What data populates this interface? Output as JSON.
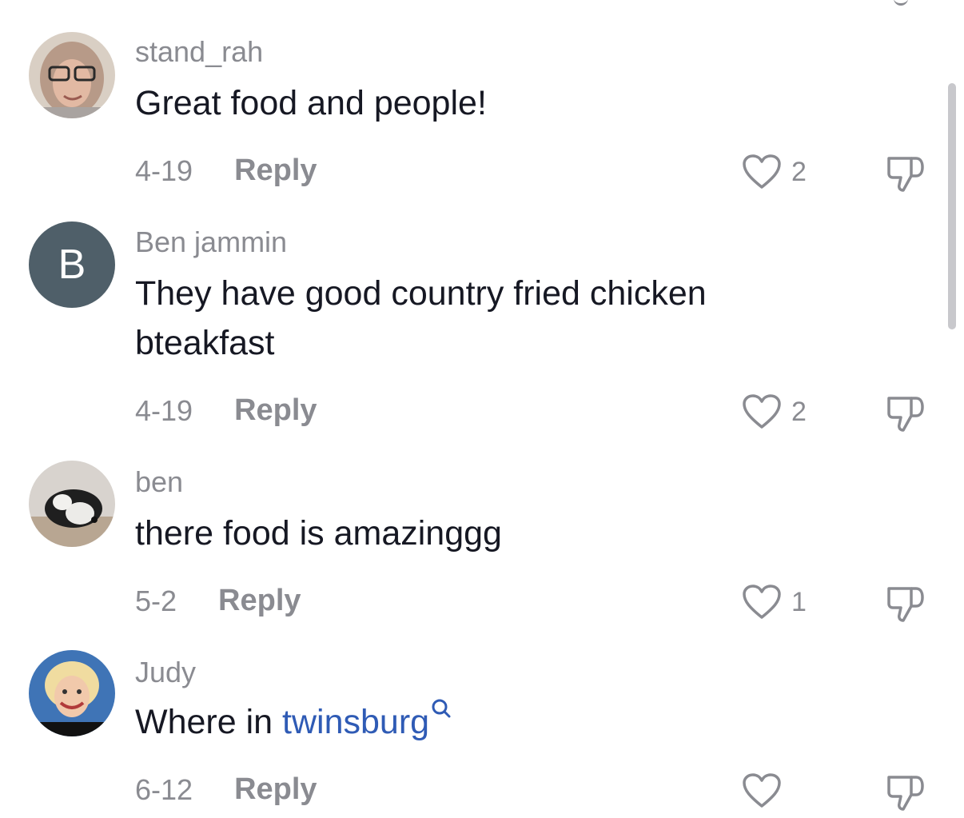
{
  "comments": [
    {
      "username": "stand_rah",
      "text": "Great food and people!",
      "date": "4-19",
      "reply": "Reply",
      "likes": "2"
    },
    {
      "username": "Ben jammin",
      "avatar_letter": "B",
      "text": "They have good country fried chicken bteakfast",
      "date": "4-19",
      "reply": "Reply",
      "likes": "2"
    },
    {
      "username": "ben",
      "text": "there food is amazinggg",
      "date": "5-2",
      "reply": "Reply",
      "likes": "1"
    },
    {
      "username": "Judy",
      "text_prefix": "Where in ",
      "hashtag": "twinsburg",
      "date": "6-12",
      "reply": "Reply",
      "likes": ""
    }
  ],
  "colors": {
    "accent_link": "#2f5bb5",
    "muted": "#8a8b91",
    "letter_avatar": "#4f5f69"
  }
}
